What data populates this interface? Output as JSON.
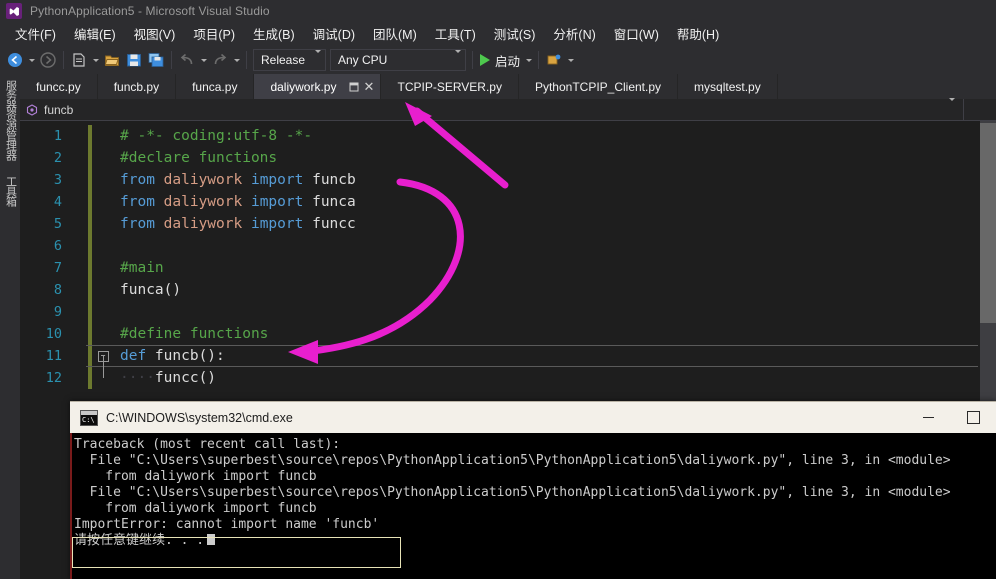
{
  "window": {
    "title": "PythonApplication5 - Microsoft Visual Studio",
    "logo_icon": "visual-studio-logo-icon"
  },
  "menubar": {
    "items": [
      {
        "label": "文件(F)"
      },
      {
        "label": "编辑(E)"
      },
      {
        "label": "视图(V)"
      },
      {
        "label": "项目(P)"
      },
      {
        "label": "生成(B)"
      },
      {
        "label": "调试(D)"
      },
      {
        "label": "团队(M)"
      },
      {
        "label": "工具(T)"
      },
      {
        "label": "测试(S)"
      },
      {
        "label": "分析(N)"
      },
      {
        "label": "窗口(W)"
      },
      {
        "label": "帮助(H)"
      }
    ]
  },
  "toolbar": {
    "nav_back_icon": "navigate-back-icon",
    "nav_forward_icon": "navigate-forward-icon",
    "new_project_icon": "new-project-icon",
    "open_file_icon": "open-file-icon",
    "save_icon": "save-icon",
    "save_all_icon": "save-all-icon",
    "undo_icon": "undo-icon",
    "redo_icon": "redo-icon",
    "config_label": "Release",
    "platform_label": "Any CPU",
    "run_label": "启动",
    "run_icon": "play-icon",
    "attach_icon": "attach-to-process-icon"
  },
  "left_rail": {
    "items": [
      {
        "label": "服务器资源管理器"
      },
      {
        "label": "工具箱"
      }
    ]
  },
  "tabs": {
    "items": [
      {
        "label": "funcc.py",
        "active": false
      },
      {
        "label": "funcb.py",
        "active": false
      },
      {
        "label": "funca.py",
        "active": false
      },
      {
        "label": "daliywork.py",
        "active": true
      },
      {
        "label": "TCPIP-SERVER.py",
        "active": false
      },
      {
        "label": "PythonTCPIP_Client.py",
        "active": false
      },
      {
        "label": "mysqltest.py",
        "active": false
      }
    ],
    "pin_icon": "pin-tab-icon",
    "close_icon": "close-tab-icon"
  },
  "navbar": {
    "scope_label": "funcb",
    "scope_icon": "python-member-icon",
    "caret_icon": "chevron-down-icon"
  },
  "editor": {
    "lines": [
      {
        "n": "1",
        "fold": false,
        "current": false,
        "tokens": [
          {
            "t": "# -*- coding:utf-8 -*-",
            "c": "tok-comment"
          }
        ]
      },
      {
        "n": "2",
        "fold": false,
        "current": false,
        "tokens": [
          {
            "t": "#declare functions",
            "c": "tok-comment"
          }
        ]
      },
      {
        "n": "3",
        "fold": false,
        "current": false,
        "tokens": [
          {
            "t": "from",
            "c": "tok-kw"
          },
          {
            "t": " ",
            "c": "tok-plain"
          },
          {
            "t": "daliywork",
            "c": "tok-mod"
          },
          {
            "t": " ",
            "c": "tok-plain"
          },
          {
            "t": "import",
            "c": "tok-kw"
          },
          {
            "t": " funcb",
            "c": "tok-plain"
          }
        ]
      },
      {
        "n": "4",
        "fold": false,
        "current": false,
        "tokens": [
          {
            "t": "from",
            "c": "tok-kw"
          },
          {
            "t": " ",
            "c": "tok-plain"
          },
          {
            "t": "daliywork",
            "c": "tok-mod"
          },
          {
            "t": " ",
            "c": "tok-plain"
          },
          {
            "t": "import",
            "c": "tok-kw"
          },
          {
            "t": " funca",
            "c": "tok-plain"
          }
        ]
      },
      {
        "n": "5",
        "fold": false,
        "current": false,
        "tokens": [
          {
            "t": "from",
            "c": "tok-kw"
          },
          {
            "t": " ",
            "c": "tok-plain"
          },
          {
            "t": "daliywork",
            "c": "tok-mod"
          },
          {
            "t": " ",
            "c": "tok-plain"
          },
          {
            "t": "import",
            "c": "tok-kw"
          },
          {
            "t": " funcc",
            "c": "tok-plain"
          }
        ]
      },
      {
        "n": "6",
        "fold": false,
        "current": false,
        "tokens": []
      },
      {
        "n": "7",
        "fold": false,
        "current": false,
        "tokens": [
          {
            "t": "#main",
            "c": "tok-comment"
          }
        ]
      },
      {
        "n": "8",
        "fold": false,
        "current": false,
        "tokens": [
          {
            "t": "funca()",
            "c": "tok-plain"
          }
        ]
      },
      {
        "n": "9",
        "fold": false,
        "current": false,
        "tokens": []
      },
      {
        "n": "10",
        "fold": false,
        "current": false,
        "tokens": [
          {
            "t": "#define functions",
            "c": "tok-comment"
          }
        ]
      },
      {
        "n": "11",
        "fold": true,
        "current": true,
        "tokens": [
          {
            "t": "def",
            "c": "tok-def"
          },
          {
            "t": " funcb():",
            "c": "tok-plain"
          }
        ]
      },
      {
        "n": "12",
        "fold": false,
        "current": false,
        "tokens": [
          {
            "t": "····",
            "c": "tok-ws"
          },
          {
            "t": "funcc()",
            "c": "tok-plain"
          }
        ]
      }
    ],
    "fold_glyph": "−"
  },
  "console": {
    "title": "C:\\WINDOWS\\system32\\cmd.exe",
    "icon": "cmd-console-icon",
    "minimize_label": "minimize-icon",
    "maximize_label": "maximize-icon",
    "lines": [
      "Traceback (most recent call last):",
      "  File \"C:\\Users\\superbest\\source\\repos\\PythonApplication5\\PythonApplication5\\daliywork.py\", line 3, in <module>",
      "    from daliywork import funcb",
      "  File \"C:\\Users\\superbest\\source\\repos\\PythonApplication5\\PythonApplication5\\daliywork.py\", line 3, in <module>",
      "    from daliywork import funcb",
      "ImportError: cannot import name 'funcb'",
      "请按任意键继续. . ."
    ]
  },
  "annotations": {
    "arrow_color": "#e81fce",
    "highlight_box_color": "#e8e4b8",
    "arrow_to_tab": "arrow-pointing-to-daliywork-tab",
    "arrow_to_def": "curved-arrow-from-import-to-def-funcb",
    "error_highlight": "importerror-highlight-box"
  }
}
